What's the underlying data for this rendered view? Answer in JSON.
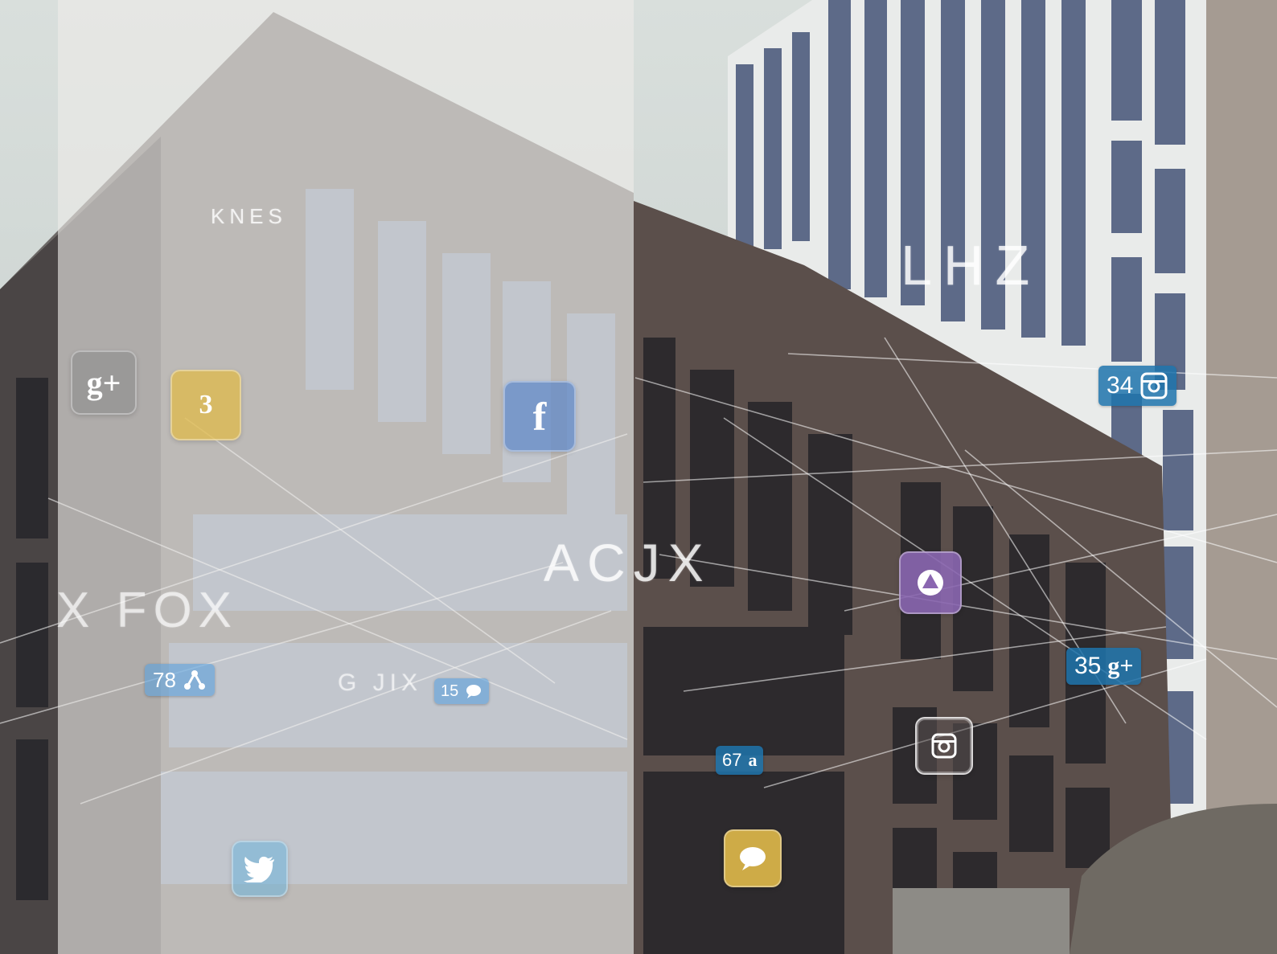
{
  "scene": {
    "description_free": true,
    "colors": {
      "badge_blue": "#1f74ad",
      "facebook_blue": "#5b86c7",
      "google_gray": "#8a8a8a",
      "yellow": "#e0b94a",
      "purple": "#8a66b0",
      "instagram_outline": "#ffffff"
    }
  },
  "overlay_words": {
    "kness": "KNES",
    "lhz": "LHZ",
    "acjx": "ACJX",
    "xfox": "X FOX",
    "gjix": "G JIX"
  },
  "app_tiles": [
    {
      "name": "google-plus",
      "icon": "google-plus-icon",
      "glyph": "g+"
    },
    {
      "name": "yellow-app",
      "icon": "yellow-app-icon",
      "glyph": "3"
    },
    {
      "name": "facebook",
      "icon": "facebook-icon",
      "glyph": "f"
    },
    {
      "name": "purple-app",
      "icon": "purple-app-icon",
      "glyph": ""
    },
    {
      "name": "instagram",
      "icon": "instagram-icon",
      "glyph": ""
    },
    {
      "name": "yellow-chat",
      "icon": "chat-bubble-icon",
      "glyph": ""
    },
    {
      "name": "twitter",
      "icon": "twitter-icon",
      "glyph": ""
    }
  ],
  "count_badges": {
    "instagram_count": "34",
    "google_count": "35",
    "share_count": "78",
    "comment_count": "15",
    "amazon_count": "67"
  }
}
